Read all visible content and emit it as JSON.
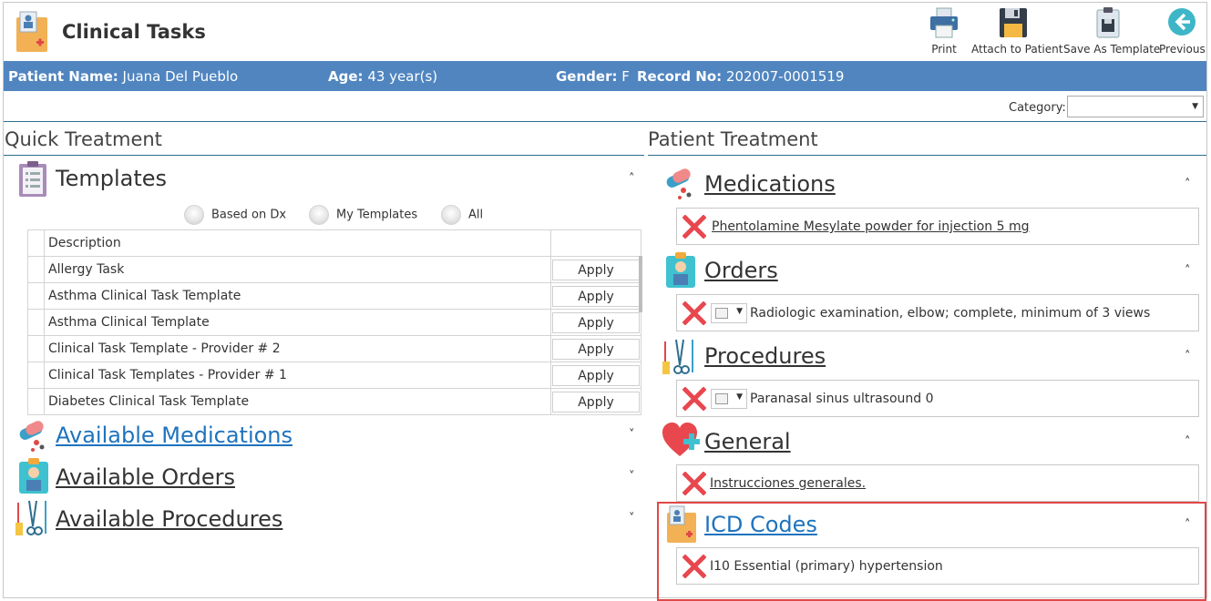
{
  "app": {
    "title": "Clinical Tasks"
  },
  "toolbar": {
    "print": "Print",
    "attach": "Attach to Patient",
    "save_template": "Save As Template",
    "previous": "Previous"
  },
  "patient": {
    "name_label": "Patient Name:",
    "name": "Juana Del Pueblo",
    "age_label": "Age:",
    "age": "43 year(s)",
    "gender_label": "Gender:",
    "gender": "F",
    "record_label": "Record No:",
    "record": "202007-0001519"
  },
  "filter": {
    "category_label": "Category:",
    "category_value": ""
  },
  "quick": {
    "heading": "Quick Treatment",
    "templates_title": "Templates",
    "radio_options": [
      "Based on Dx",
      "My Templates",
      "All"
    ],
    "table_header": "Description",
    "apply_label": "Apply",
    "rows": [
      "Allergy Task",
      "Asthma Clinical Task Template",
      "Asthma Clinical Template",
      "Clinical Task Template - Provider # 2",
      "Clinical Task Templates - Provider # 1",
      "Diabetes Clinical Task Template"
    ],
    "available_medications": "Available Medications",
    "available_orders": "Available Orders",
    "available_procedures": "Available Procedures"
  },
  "patient_treatment": {
    "heading": "Patient Treatment",
    "medications_title": "Medications",
    "medications_item": "Phentolamine Mesylate powder for injection 5 mg",
    "orders_title": "Orders",
    "orders_item": "Radiologic examination, elbow; complete, minimum of 3 views",
    "procedures_title": "Procedures",
    "procedures_item": "Paranasal sinus ultrasound 0",
    "general_title": "General",
    "general_item": "Instrucciones generales.",
    "icd_title": "ICD Codes",
    "icd_item": "I10 Essential (primary) hypertension"
  },
  "colors": {
    "patient_bar": "#5085c0",
    "link": "#1e73be",
    "remove_x": "#e8474e",
    "highlight": "#e04848"
  },
  "icons": {
    "app": "clipboard-doctor-icon",
    "print": "printer-icon",
    "attach": "floppy-disk-icon",
    "save_template": "clipboard-save-icon",
    "previous": "back-arrow-icon",
    "templates": "clipboard-list-icon",
    "medications": "pills-icon",
    "orders": "doctor-icon",
    "procedures": "surgical-tools-icon",
    "general": "heart-plus-icon",
    "icd": "patient-card-icon",
    "remove": "x-icon"
  }
}
